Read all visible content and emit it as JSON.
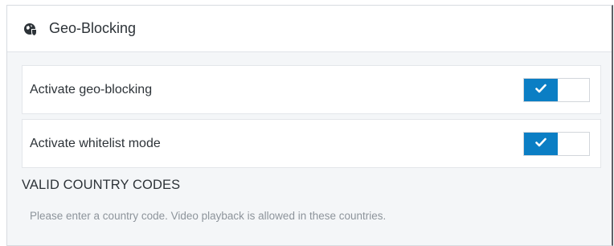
{
  "panel": {
    "title": "Geo-Blocking",
    "icon": "globe-shield-icon"
  },
  "settings": [
    {
      "label": "Activate geo-blocking",
      "enabled": true,
      "icon": "checkmark-icon"
    },
    {
      "label": "Activate whitelist mode",
      "enabled": true,
      "icon": "checkmark-icon"
    }
  ],
  "country_codes": {
    "heading": "VALID COUNTRY CODES",
    "helper": "Please enter a country code. Video playback is allowed in these countries."
  },
  "colors": {
    "accent": "#0b7ec4",
    "background": "#f4f6f8"
  }
}
